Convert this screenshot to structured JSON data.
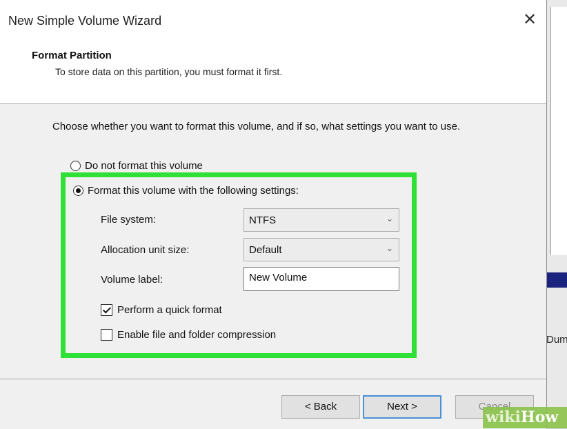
{
  "window": {
    "title": "New Simple Volume Wizard",
    "close_glyph": "✕"
  },
  "header": {
    "title": "Format Partition",
    "subtitle": "To store data on this partition, you must format it first."
  },
  "body": {
    "instructions": "Choose whether you want to format this volume, and if so, what settings you want to use.",
    "option_no_format": {
      "label": "Do not format this volume",
      "selected": false
    },
    "option_format": {
      "label": "Format this volume with the following settings:",
      "selected": true
    },
    "file_system": {
      "label": "File system:",
      "value": "NTFS"
    },
    "allocation_unit_size": {
      "label": "Allocation unit size:",
      "value": "Default"
    },
    "volume_label": {
      "label": "Volume label:",
      "value": "New Volume"
    },
    "quick_format": {
      "label": "Perform a quick format",
      "checked": true
    },
    "compression": {
      "label": "Enable file and folder compression",
      "checked": false
    }
  },
  "footer": {
    "back_label": "< Back",
    "next_label": "Next >",
    "cancel_label": "Cancel"
  },
  "background_app": {
    "snippet_1": "D",
    "snippet_2": "Dum"
  },
  "watermark": {
    "wiki": "wiki",
    "how": "How"
  },
  "colors": {
    "highlight": "#2fe037",
    "focus_border": "#4a90d9"
  },
  "icons": {
    "close": "close-icon",
    "dropdown": "chevron-down-icon"
  }
}
